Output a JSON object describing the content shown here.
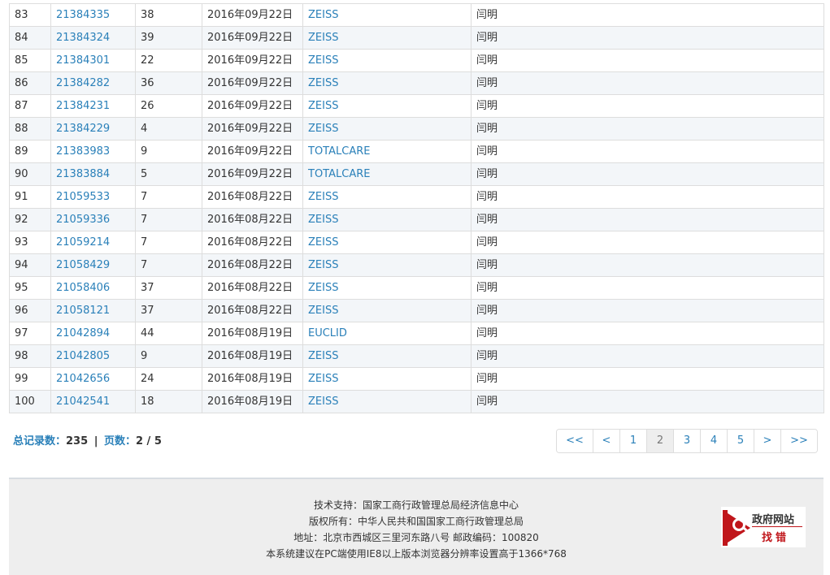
{
  "table": {
    "rows": [
      {
        "idx": "83",
        "reg_no": "21384335",
        "class": "38",
        "date": "2016年09月22日",
        "brand": "ZEISS",
        "agent": "闫明"
      },
      {
        "idx": "84",
        "reg_no": "21384324",
        "class": "39",
        "date": "2016年09月22日",
        "brand": "ZEISS",
        "agent": "闫明"
      },
      {
        "idx": "85",
        "reg_no": "21384301",
        "class": "22",
        "date": "2016年09月22日",
        "brand": "ZEISS",
        "agent": "闫明"
      },
      {
        "idx": "86",
        "reg_no": "21384282",
        "class": "36",
        "date": "2016年09月22日",
        "brand": "ZEISS",
        "agent": "闫明"
      },
      {
        "idx": "87",
        "reg_no": "21384231",
        "class": "26",
        "date": "2016年09月22日",
        "brand": "ZEISS",
        "agent": "闫明"
      },
      {
        "idx": "88",
        "reg_no": "21384229",
        "class": "4",
        "date": "2016年09月22日",
        "brand": "ZEISS",
        "agent": "闫明"
      },
      {
        "idx": "89",
        "reg_no": "21383983",
        "class": "9",
        "date": "2016年09月22日",
        "brand": "TOTALCARE",
        "agent": "闫明"
      },
      {
        "idx": "90",
        "reg_no": "21383884",
        "class": "5",
        "date": "2016年09月22日",
        "brand": "TOTALCARE",
        "agent": "闫明"
      },
      {
        "idx": "91",
        "reg_no": "21059533",
        "class": "7",
        "date": "2016年08月22日",
        "brand": "ZEISS",
        "agent": "闫明"
      },
      {
        "idx": "92",
        "reg_no": "21059336",
        "class": "7",
        "date": "2016年08月22日",
        "brand": "ZEISS",
        "agent": "闫明"
      },
      {
        "idx": "93",
        "reg_no": "21059214",
        "class": "7",
        "date": "2016年08月22日",
        "brand": "ZEISS",
        "agent": "闫明"
      },
      {
        "idx": "94",
        "reg_no": "21058429",
        "class": "7",
        "date": "2016年08月22日",
        "brand": "ZEISS",
        "agent": "闫明"
      },
      {
        "idx": "95",
        "reg_no": "21058406",
        "class": "37",
        "date": "2016年08月22日",
        "brand": "ZEISS",
        "agent": "闫明"
      },
      {
        "idx": "96",
        "reg_no": "21058121",
        "class": "37",
        "date": "2016年08月22日",
        "brand": "ZEISS",
        "agent": "闫明"
      },
      {
        "idx": "97",
        "reg_no": "21042894",
        "class": "44",
        "date": "2016年08月19日",
        "brand": "EUCLID",
        "agent": "闫明"
      },
      {
        "idx": "98",
        "reg_no": "21042805",
        "class": "9",
        "date": "2016年08月19日",
        "brand": "ZEISS",
        "agent": "闫明"
      },
      {
        "idx": "99",
        "reg_no": "21042656",
        "class": "24",
        "date": "2016年08月19日",
        "brand": "ZEISS",
        "agent": "闫明"
      },
      {
        "idx": "100",
        "reg_no": "21042541",
        "class": "18",
        "date": "2016年08月19日",
        "brand": "ZEISS",
        "agent": "闫明"
      }
    ]
  },
  "summary": {
    "total_label": "总记录数：",
    "total_value": "235",
    "separator": "|",
    "pages_label": "页数：",
    "pages_value": "2 / 5"
  },
  "pager": {
    "first": "<<",
    "prev": "<",
    "pages": [
      "1",
      "2",
      "3",
      "4",
      "5"
    ],
    "active": "2",
    "next": ">",
    "last": ">>"
  },
  "footer": {
    "support": "技术支持：国家工商行政管理总局经济信息中心",
    "copyright": "版权所有：中华人民共和国国家工商行政管理总局",
    "address": "地址：北京市西城区三里河东路八号  邮政编码：100820",
    "advice": "本系统建议在PC端使用IE8以上版本浏览器分辨率设置高于1366*768",
    "badge_title": "政府网站",
    "badge_sub": "找错"
  },
  "colors": {
    "link": "#2a80b9",
    "badge_red": "#c0161b"
  }
}
